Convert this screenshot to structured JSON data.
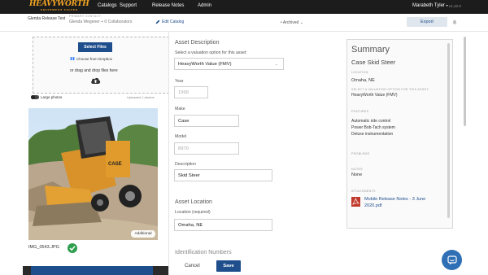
{
  "nav": {
    "logo": "HEAVYWORTH",
    "logo_sub": "EQUIPMENT VALUES",
    "items": [
      "Catalogs",
      "Support",
      "Release Notes",
      "Admin"
    ],
    "user": "Marabeth Tyler",
    "version": "v1.22.0"
  },
  "subheader": {
    "catalog_name": "Glenda Release Test",
    "primary_contact_label": "PRIMARY CONTACT:",
    "primary_contact": "Glenda Wegener + 0 Collaborators",
    "edit_catalog": "Edit Catalog",
    "status": "Archived",
    "export": "Export"
  },
  "upload": {
    "select_files": "Select Files",
    "dropbox": "Choose from Dropbox",
    "drag_text": "or drag and drop files here",
    "large_photos": "Large photos",
    "uploaded": "Uploaded 1 photos",
    "additional_badge": "Additional",
    "image_name": "IMG_0543.JPG"
  },
  "form": {
    "asset_description_heading": "Asset Description",
    "valuation_label": "Select a valuation option for this asset:",
    "valuation_value": "HeavyWorth Value (FMV)",
    "year_label": "Year",
    "year_placeholder": "1999",
    "make_label": "Make",
    "make_value": "Case",
    "model_label": "Model",
    "model_placeholder": "8970",
    "description_label": "Description",
    "description_value": "Skid Steer",
    "asset_location_heading": "Asset Location",
    "location_label": "Location (required)",
    "location_value": "Omaha, NE",
    "identification_heading": "Identification Numbers",
    "cancel": "Cancel",
    "save": "Save"
  },
  "summary": {
    "heading": "Summary",
    "asset_name": "Case Skid Steer",
    "location_caption": "LOCATION",
    "location": "Omaha, NE",
    "valuation_caption": "SELECT A VALUATION OPTION FOR THIS ASSET:",
    "valuation": "HeavyWorth Value (FMV)",
    "features_caption": "FEATURES",
    "features": [
      "Automatic ride control",
      "Power Bob-Tach system",
      "Deluxe instrumentation"
    ],
    "problems_caption": "PROBLEMS",
    "notes_caption": "NOTES",
    "notes": "None",
    "attachments_caption": "ATTACHMENTS",
    "attachment_line1": "Mobile Release Notes - 3 June",
    "attachment_line2": "2020.pdf"
  },
  "colors": {
    "nav_bg": "#1c1c1c",
    "accent_orange": "#f5a623",
    "primary_blue": "#1f4e8c",
    "success_green": "#2e9e4f"
  }
}
